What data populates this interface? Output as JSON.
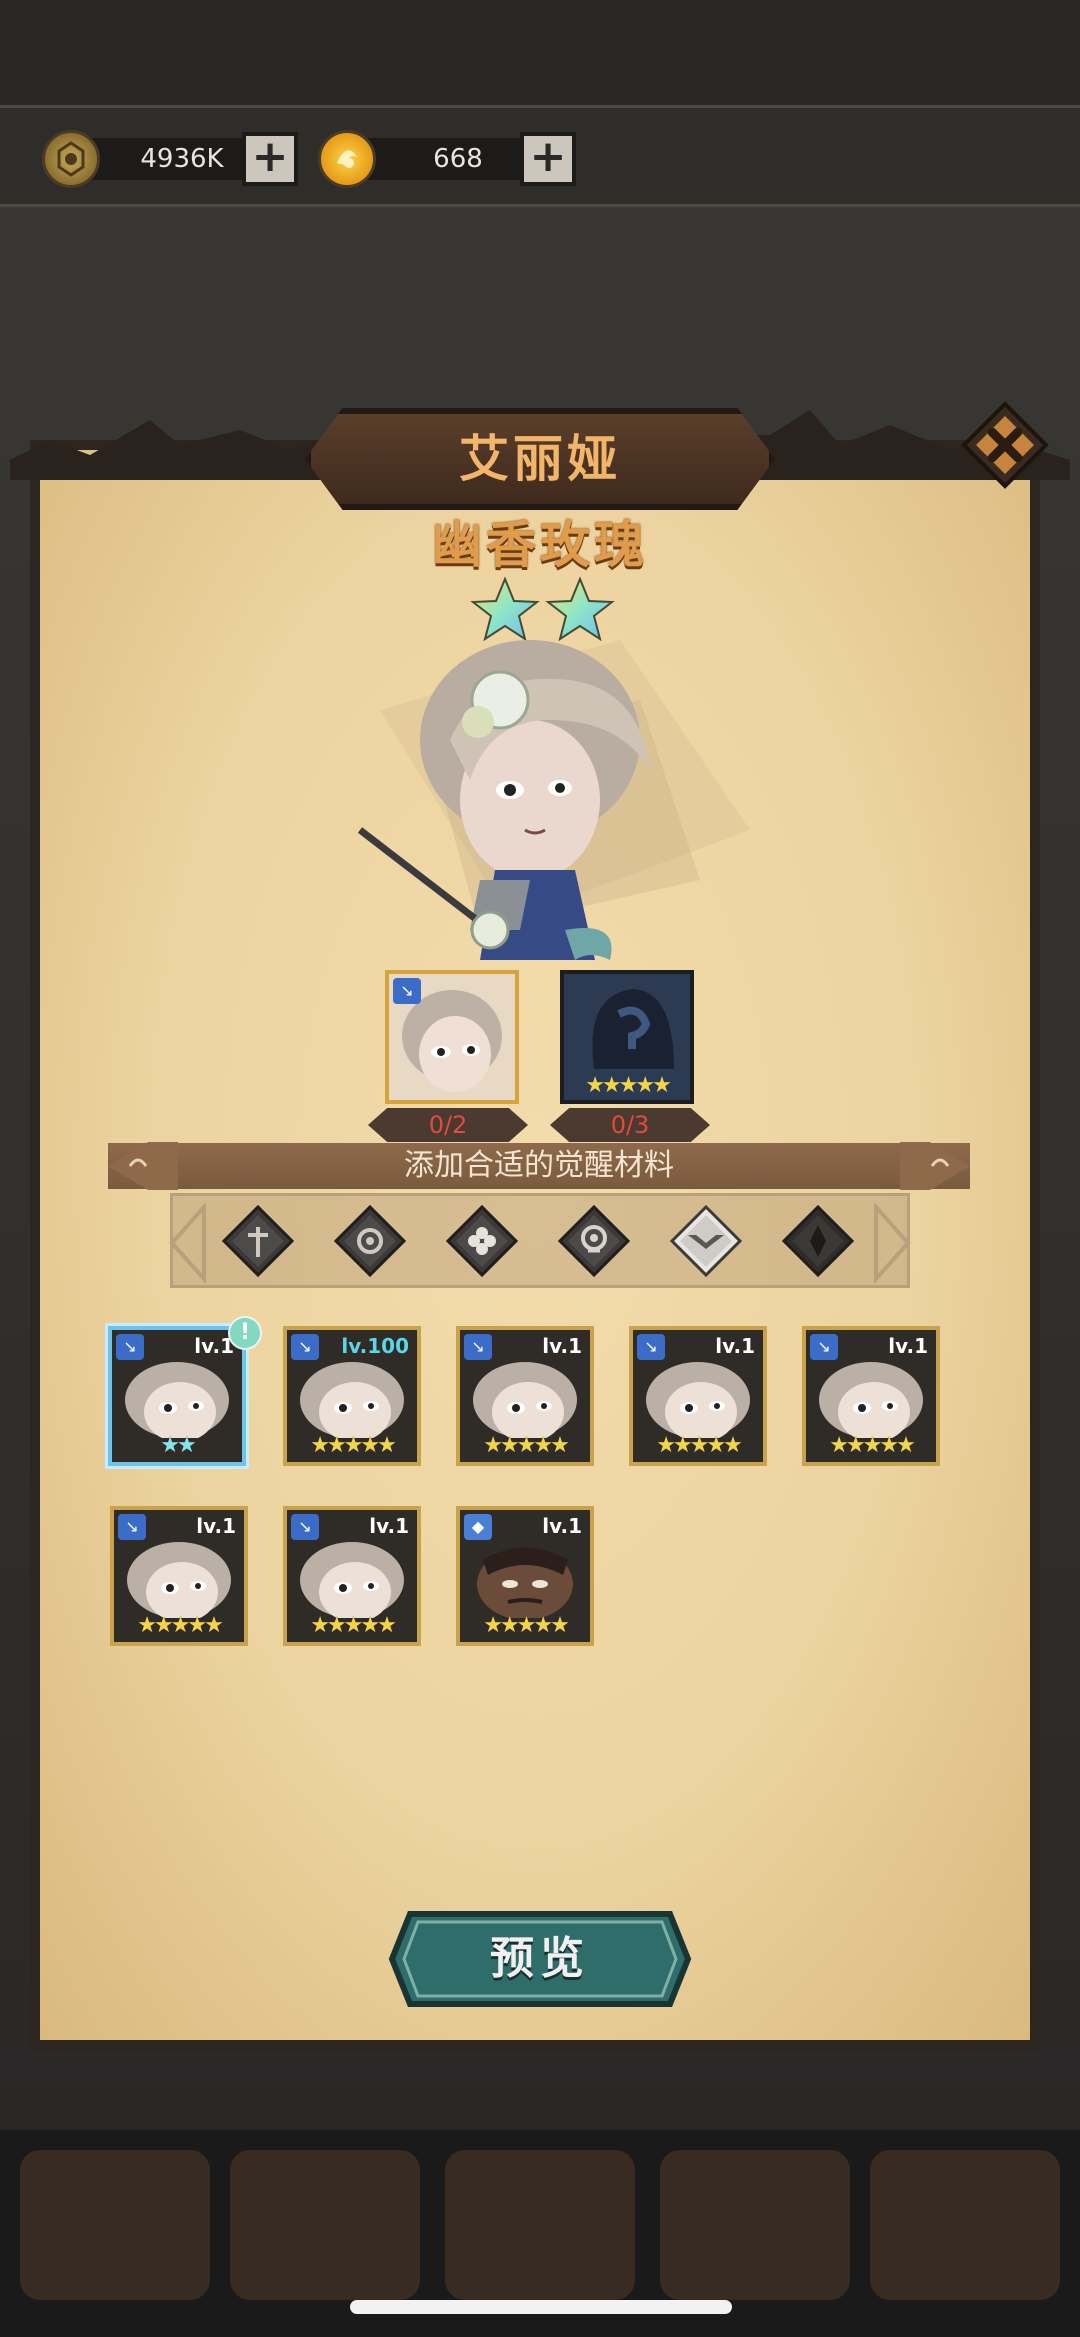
{
  "currency": {
    "gold": {
      "value": "4936K",
      "icon": "gold-coin-icon"
    },
    "gem": {
      "value": "668",
      "icon": "awaken-token-icon"
    },
    "plus_label": "+"
  },
  "dialog": {
    "hero_name": "艾丽娅",
    "skin_name": "幽香玫瑰",
    "close_icon": "close-x-icon"
  },
  "materials": [
    {
      "count": "0/2"
    },
    {
      "count": "0/3"
    }
  ],
  "hint": "添加合适的觉醒材料",
  "filters": [
    "cross-staff-icon",
    "gear-wheel-icon",
    "clover-icon",
    "eye-mask-icon",
    "winged-eye-icon",
    "dark-spire-icon"
  ],
  "cards": [
    {
      "level": "lv.1",
      "stars": "★★",
      "star_color": "cyan",
      "selected": true,
      "badge": "!"
    },
    {
      "level": "lv.100",
      "stars": "★★★★★",
      "high": true
    },
    {
      "level": "lv.1",
      "stars": "★★★★★"
    },
    {
      "level": "lv.1",
      "stars": "★★★★★"
    },
    {
      "level": "lv.1",
      "stars": "★★★★★"
    },
    {
      "level": "lv.1",
      "stars": "★★★★★"
    },
    {
      "level": "lv.1",
      "stars": "★★★★★"
    },
    {
      "level": "lv.1",
      "stars": "★★★★★"
    }
  ],
  "material_stars": "★★★★★",
  "preview_label": "预览",
  "colors": {
    "parchment": "#ecd39f",
    "title_text": "#f2b56a",
    "subtitle_text": "#e09b4b",
    "counter_text": "#e24a3e",
    "card_border": "#c9a24c",
    "selected_border": "#6fc3ea",
    "preview_button": "#2f6d6b"
  }
}
